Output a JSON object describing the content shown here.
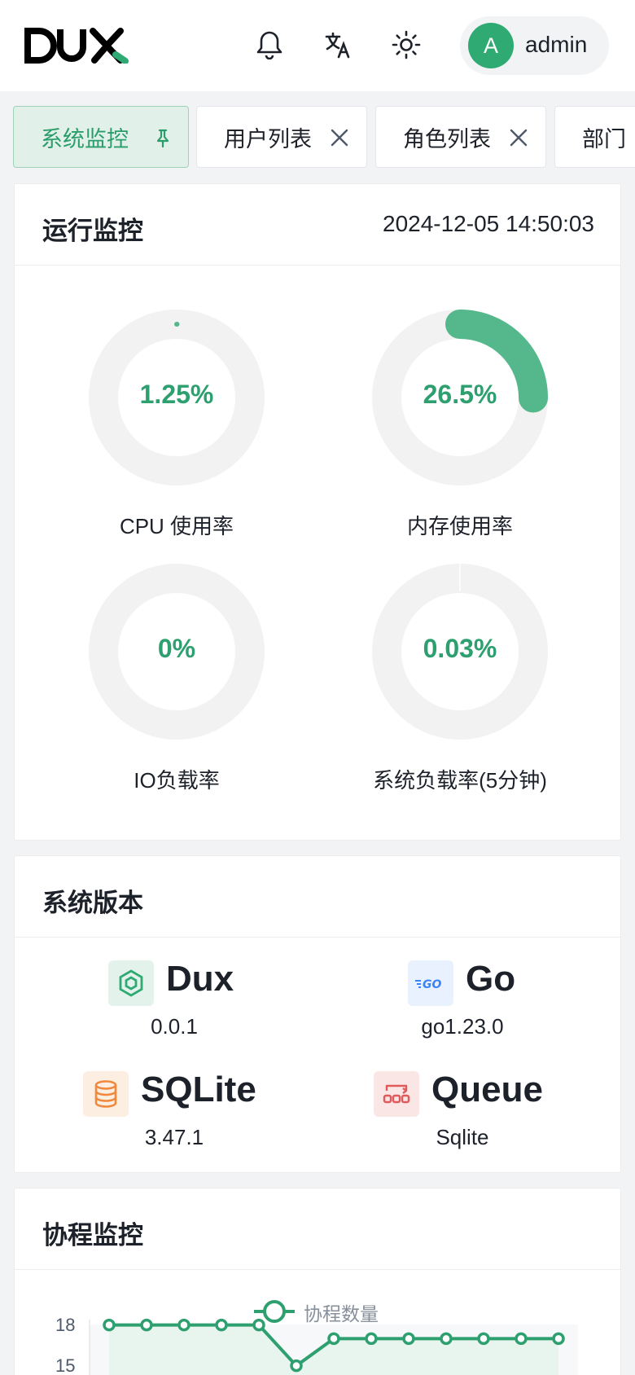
{
  "header": {
    "user_initial": "A",
    "user_name": "admin"
  },
  "tabs": [
    {
      "label": "系统监控",
      "active": true
    },
    {
      "label": "用户列表",
      "active": false
    },
    {
      "label": "角色列表",
      "active": false
    },
    {
      "label": "部门",
      "active": false
    }
  ],
  "monitor": {
    "title": "运行监控",
    "time": "2024-12-05 14:50:03",
    "gauges": [
      {
        "value_text": "1.25%",
        "percent": 1.25,
        "label": "CPU 使用率"
      },
      {
        "value_text": "26.5%",
        "percent": 26.5,
        "label": "内存使用率"
      },
      {
        "value_text": "0%",
        "percent": 0,
        "label": "IO负载率"
      },
      {
        "value_text": "0.03%",
        "percent": 0.03,
        "label": "系统负载率(5分钟)"
      }
    ]
  },
  "versions": {
    "title": "系统版本",
    "items": [
      {
        "name": "Dux",
        "version": "0.0.1",
        "icon": "hexagon-icon",
        "color": "#2eaa72"
      },
      {
        "name": "Go",
        "version": "go1.23.0",
        "icon": "go-logo-icon",
        "color": "#3b82f6"
      },
      {
        "name": "SQLite",
        "version": "3.47.1",
        "icon": "database-icon",
        "color": "#f0883e"
      },
      {
        "name": "Queue",
        "version": "Sqlite",
        "icon": "queue-icon",
        "color": "#e05a5a"
      }
    ]
  },
  "goroutine": {
    "title": "协程监控",
    "chart_data": {
      "type": "line",
      "series": [
        {
          "name": "协程数量",
          "values": [
            17,
            17,
            17,
            17,
            17,
            14,
            16,
            16,
            16,
            16,
            16,
            16,
            16
          ]
        }
      ],
      "y_ticks": [
        "18",
        "15"
      ],
      "ylim": [
        0,
        18
      ],
      "color": "#2e9f6f"
    }
  },
  "colors": {
    "accent": "#2eaa72",
    "gauge_track": "#f2f2f2"
  }
}
